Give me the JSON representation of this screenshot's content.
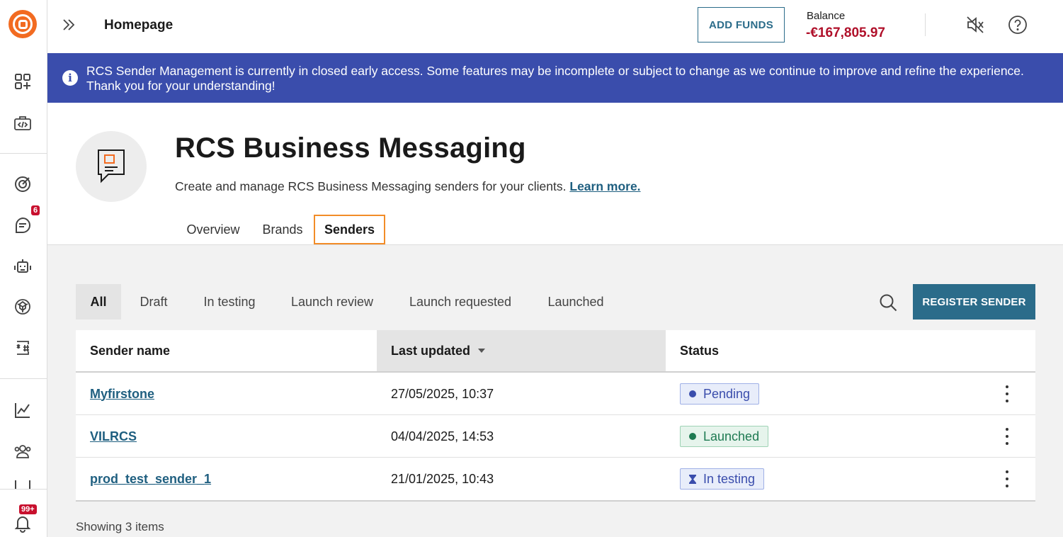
{
  "topbar": {
    "breadcrumb": "Homepage",
    "add_funds_label": "ADD FUNDS",
    "balance_label": "Balance",
    "balance_value": "-€167,805.97"
  },
  "rail": {
    "messages_badge": "6",
    "notifications_badge": "99+"
  },
  "banner": {
    "message": "RCS Sender Management is currently in closed early access. Some features may be incomplete or subject to change as we continue to improve and refine the experience. Thank you for your understanding!"
  },
  "header": {
    "title": "RCS Business Messaging",
    "subtitle": "Create and manage RCS Business Messaging senders for your clients.",
    "learn_more": "Learn more.",
    "tabs": [
      {
        "label": "Overview"
      },
      {
        "label": "Brands"
      },
      {
        "label": "Senders"
      }
    ],
    "active_tab": "Senders"
  },
  "filters": {
    "items": [
      {
        "label": "All"
      },
      {
        "label": "Draft"
      },
      {
        "label": "In testing"
      },
      {
        "label": "Launch review"
      },
      {
        "label": "Launch requested"
      },
      {
        "label": "Launched"
      }
    ],
    "active": "All",
    "register_label": "REGISTER SENDER"
  },
  "table": {
    "columns": [
      {
        "label": "Sender name"
      },
      {
        "label": "Last updated"
      },
      {
        "label": "Status"
      }
    ],
    "sorted_column": "Last updated",
    "rows": [
      {
        "name": "Myfirstone",
        "updated": "27/05/2025, 10:37",
        "status": "Pending"
      },
      {
        "name": "VILRCS",
        "updated": "04/04/2025, 14:53",
        "status": "Launched"
      },
      {
        "name": "prod_test_sender_1",
        "updated": "21/01/2025, 10:43",
        "status": "In testing"
      }
    ]
  },
  "footer": {
    "showing": "Showing 3 items"
  },
  "colors": {
    "brand_orange": "#f26b21",
    "primary_teal": "#2b6c8a",
    "banner_blue": "#3a4dac",
    "balance_red": "#b0102a",
    "pending": "#3a4dac",
    "launched": "#1e7a52",
    "in_testing": "#3a4dac"
  }
}
